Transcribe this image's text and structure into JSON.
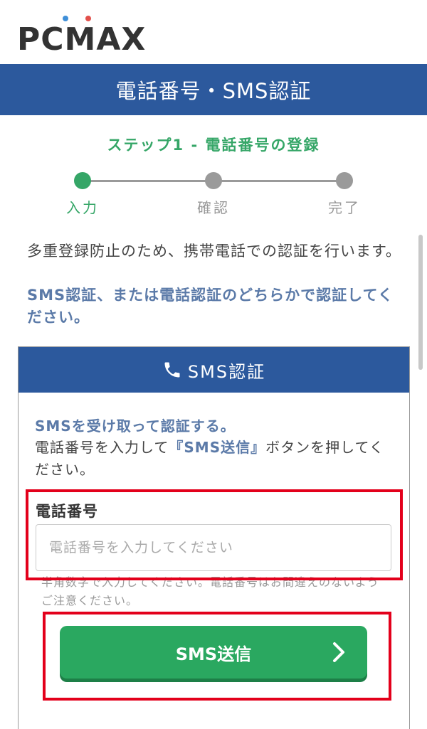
{
  "brand": {
    "logo_text": "PCMAX",
    "dot_blue": "#3f8fd8",
    "dot_red": "#e2504b"
  },
  "page": {
    "title": "電話番号・SMS認証"
  },
  "steps": {
    "title": "ステップ1 - 電話番号の登録",
    "items": [
      {
        "label": "入力",
        "state": "active"
      },
      {
        "label": "確認",
        "state": "pending"
      },
      {
        "label": "完了",
        "state": "pending"
      }
    ],
    "active_color": "#35a667"
  },
  "intro": {
    "text": "多重登録防止のため、携帯電話での認証を行います。",
    "link_text": "SMS認証、または電話認証のどちらかで認証してください。"
  },
  "sms": {
    "header_icon": "phone-icon",
    "header": "SMS認証",
    "lead": "SMSを受け取って認証する。",
    "instruction_before": "電話番号を入力して",
    "instruction_emphasis": "『SMS送信』",
    "instruction_after": "ボタンを押してください。",
    "field_label": "電話番号",
    "input_value": "",
    "input_placeholder": "電話番号を入力してください",
    "hint": "半角数字で入力してください。電話番号はお間違えのないようご注意ください。",
    "button_label": "SMS送信",
    "button_icon": "chevron-right-icon"
  },
  "colors": {
    "primary": "#2c599d",
    "accent_green": "#2aa860",
    "highlight_red": "#e3001b"
  }
}
